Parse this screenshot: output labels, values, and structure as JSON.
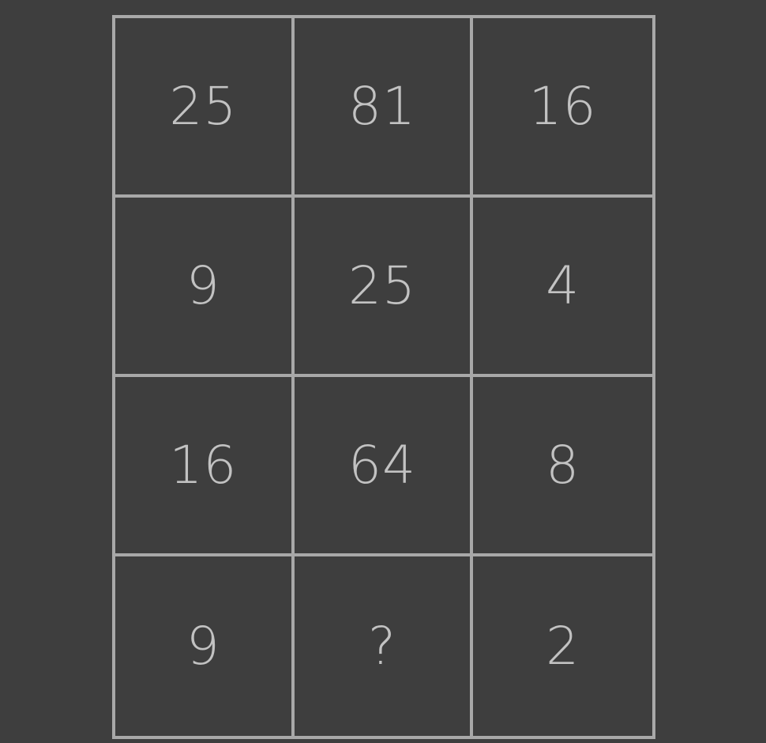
{
  "puzzle": {
    "cells": [
      [
        "25",
        "81",
        "16"
      ],
      [
        "9",
        "25",
        "4"
      ],
      [
        "16",
        "64",
        "8"
      ],
      [
        "9",
        "?",
        "2"
      ]
    ]
  },
  "colors": {
    "background": "#3e3e3e",
    "grid_lines": "#a8a8a8",
    "text": "#c2c2c2"
  }
}
